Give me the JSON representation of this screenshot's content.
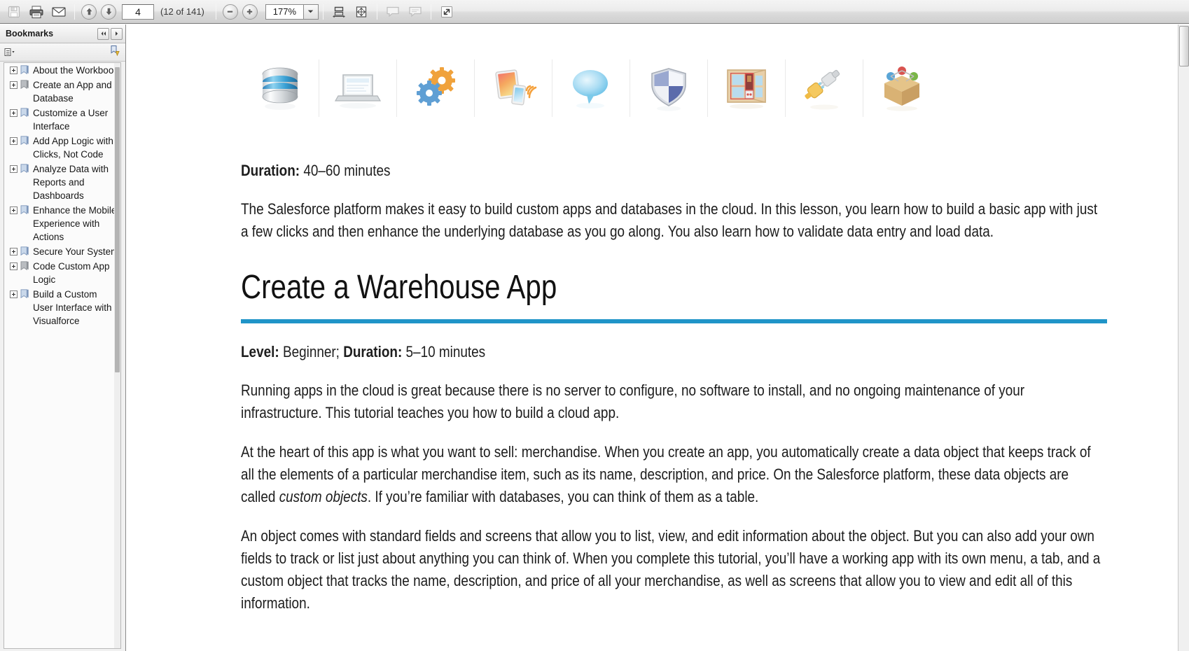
{
  "toolbar": {
    "buttons": [
      {
        "name": "save-button",
        "icon": "floppy-disk-icon",
        "label": "Save"
      },
      {
        "name": "print-button",
        "icon": "printer-icon",
        "label": "Print"
      },
      {
        "name": "email-button",
        "icon": "envelope-icon",
        "label": "Email"
      }
    ],
    "previous_page_label": "Previous Page",
    "next_page_label": "Next Page",
    "page_number": "4",
    "page_count": "(12 of 141)",
    "zoom_out_label": "Zoom Out",
    "zoom_in_label": "Zoom In",
    "zoom_value": "177%",
    "zoom_dropdown_label": "Zoom level options",
    "fit_width_label": "Fit Width",
    "fit_page_label": "Fit Page",
    "comment_label": "Add Sticky Note",
    "highlight_label": "Highlight Text",
    "fullscreen_label": "Read Mode"
  },
  "navpane": {
    "title": "Bookmarks",
    "collapse_label": "◀◀",
    "expand_label": "▶",
    "options_label": "Bookmark Options",
    "new_bookmark_label": "New Bookmark",
    "bookmarks": [
      {
        "label": "About the Workbook",
        "expanded": false
      },
      {
        "label": "Create an App and Database",
        "expanded": false
      },
      {
        "label": "Customize a User Interface",
        "expanded": false
      },
      {
        "label": "Add App Logic with Clicks, Not Code",
        "expanded": false
      },
      {
        "label": "Analyze Data with Reports and Dashboards",
        "expanded": false
      },
      {
        "label": "Enhance the Mobile Experience with Actions",
        "expanded": false
      },
      {
        "label": "Secure Your System",
        "expanded": false
      },
      {
        "label": "Code Custom App Logic",
        "expanded": false
      },
      {
        "label": "Build a Custom User Interface with Visualforce",
        "expanded": false
      }
    ]
  },
  "document": {
    "icon_strip": [
      {
        "name": "database-icon",
        "alt": "Database"
      },
      {
        "name": "laptop-icon",
        "alt": "Laptop"
      },
      {
        "name": "gears-icon",
        "alt": "Gears"
      },
      {
        "name": "mobile-devices-icon",
        "alt": "Tablet and Phone"
      },
      {
        "name": "speech-bubble-icon",
        "alt": "Speech Bubble"
      },
      {
        "name": "shield-icon",
        "alt": "Shield"
      },
      {
        "name": "window-icon",
        "alt": "Open Window"
      },
      {
        "name": "plug-icon",
        "alt": "Power Plug"
      },
      {
        "name": "package-icon",
        "alt": "Package"
      }
    ],
    "duration_label": "Duration:",
    "duration_value": " 40–60 minutes",
    "intro_paragraph": "The Salesforce platform makes it easy to build custom apps and databases in the cloud. In this lesson, you learn how to build a basic app with just a few clicks and then enhance the underlying database as you go along. You also learn how to validate data entry and load data.",
    "section_heading": "Create a Warehouse App",
    "level_label": "Level:",
    "level_value": " Beginner; ",
    "section_duration_label": "Duration:",
    "section_duration_value": " 5–10 minutes",
    "paragraphs": [
      "Running apps in the cloud is great because there is no server to configure, no software to install, and no ongoing maintenance of your infrastructure. This tutorial teaches you how to build a cloud app.",
      "An object comes with standard fields and screens that allow you to list, view, and edit information about the object. But you can also add your own fields to track or list just about anything you can think of. When you complete this tutorial, you’ll have a working app with its own menu, a tab, and a custom object that tracks the name, description, and price of all your merchandise, as well as screens that allow you to view and edit all of this information."
    ],
    "merchandise_paragraph_part1": "At the heart of this app is what you want to sell: merchandise. When you create an app, you automatically create a data object that keeps track of all the elements of a particular merchandise item, such as its name, description, and price. On the Salesforce platform, these data objects are called ",
    "merchandise_paragraph_italic": "custom objects",
    "merchandise_paragraph_part2": ". If you’re familiar with databases, you can think of them as a table."
  },
  "colors": {
    "accent_rule": "#1f94c8",
    "toolbar_bg": "#e4e4e4",
    "text": "#1c1c1c"
  }
}
